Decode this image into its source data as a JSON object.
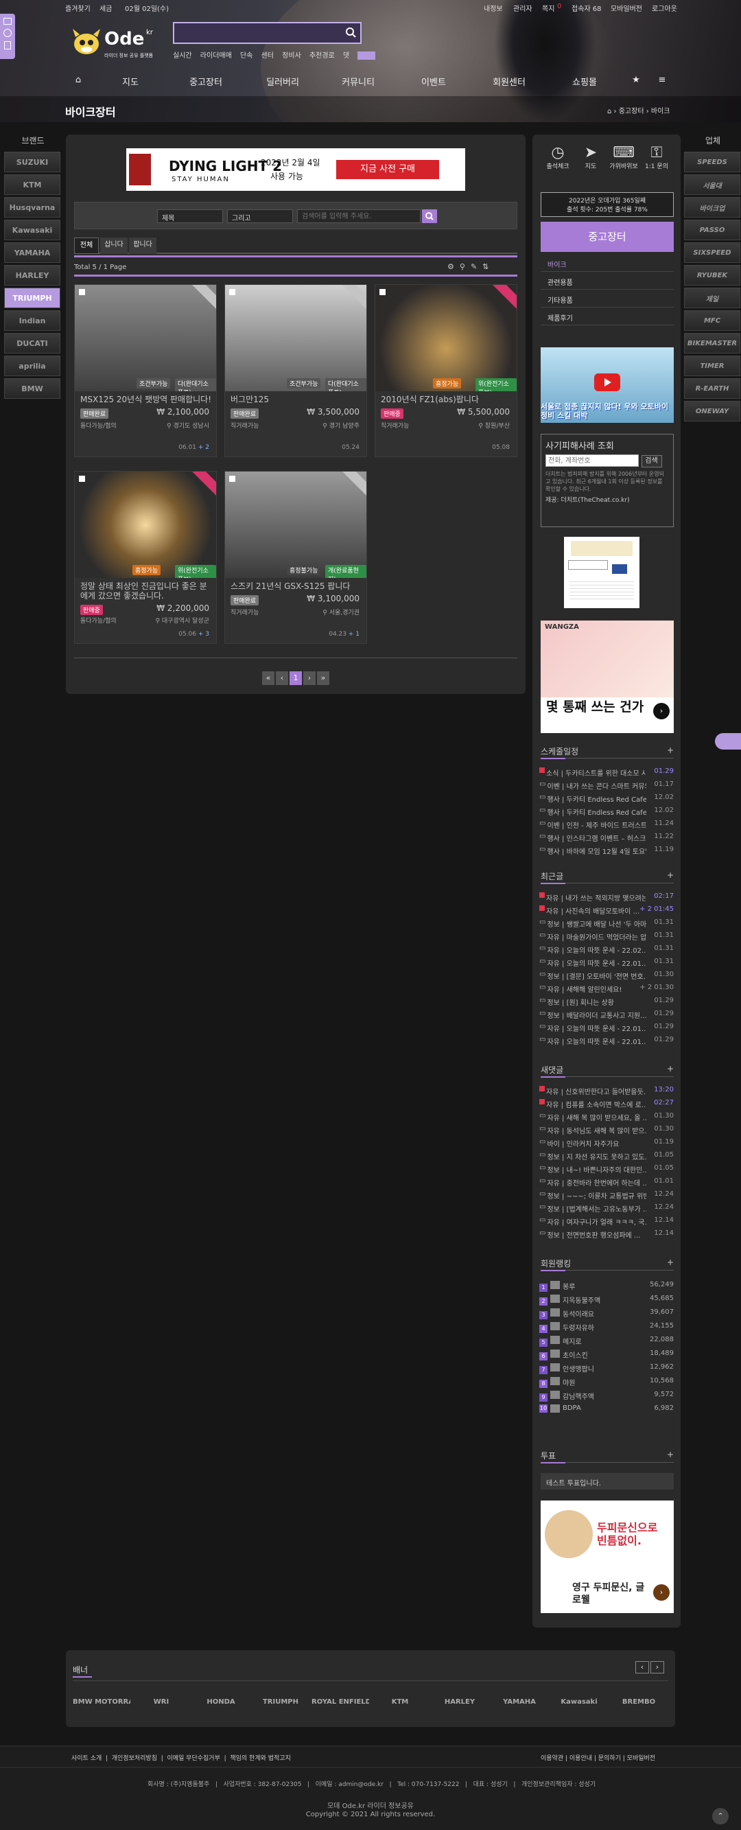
{
  "topbar": {
    "bookmark": "즐겨찾기",
    "tax": "세금",
    "date": "02월 02일(수)",
    "right": [
      "내정보",
      "관리자",
      "쪽지",
      "0",
      "접속자 68",
      "모바일버전",
      "로그아웃"
    ]
  },
  "logo": {
    "name": "Ode",
    "sub": "라이더 정보 공유 플랫폼",
    "sup": "kr"
  },
  "quick": [
    "실시간",
    "라이더매매",
    "단속",
    "센터",
    "정비사",
    "추천경로",
    "뎃"
  ],
  "nav": [
    "지도",
    "중고장터",
    "딜러버리",
    "커뮤니티",
    "이벤트",
    "회원센터",
    "쇼핑몰"
  ],
  "page": {
    "title": "바이크장터",
    "crumbs": [
      "중고장터",
      "바이크"
    ]
  },
  "left_brands_title": "브랜드",
  "left_brands": [
    "SUZUKI",
    "KTM",
    "Husqvarna",
    "Kawasaki",
    "YAMAHA",
    "HARLEY",
    "TRIUMPH",
    "Indian",
    "DUCATI",
    "aprilia",
    "BMW"
  ],
  "right_title": "업체",
  "right_brands": [
    "SPEEDS",
    "서울대",
    "바이크업",
    "PASSO",
    "SIXSPEED",
    "RYUBEK",
    "제일",
    "MFC",
    "BIKEMASTER",
    "TIMER",
    "R-EARTH",
    "ONEWAY"
  ],
  "ad": {
    "title": "DYING LIGHT 2",
    "sub": "STAY HUMAN",
    "date": "2022년 2월 4일",
    "avail": "사용 가능",
    "cta": "지금 사전 구매"
  },
  "filter": {
    "sel1": "제목",
    "sel2": "그리고",
    "ph": "검색어를 입력해 주세요."
  },
  "tabs": [
    "전체",
    "삽니다",
    "팝니다"
  ],
  "total": "Total 5 / 1 Page",
  "cards": [
    {
      "title": "MSX125 20년식 팻방역 판매합니다!",
      "badge": "판매완료",
      "price": "₩ 2,100,000",
      "loc1": "돌다가능/협의",
      "loc2": "경기도 성남시",
      "date": "06.01",
      "cmt": "+ 2",
      "tag1": "조건부가능",
      "tag2": "다(완대기소품포)"
    },
    {
      "title": "버그만125",
      "badge": "판매완료",
      "price": "₩ 3,500,000",
      "loc1": "직거래가능",
      "loc2": "경기 남양주",
      "date": "05.24",
      "cmt": "",
      "tag1": "조건부가능",
      "tag2": "다(완대기소품포)"
    },
    {
      "title": "2010년식 FZ1(abs)팝니다",
      "badge": "판매중",
      "price": "₩ 5,500,000",
      "loc1": "직거래가능",
      "loc2": "창원/부산",
      "date": "05.08",
      "cmt": "",
      "tag1": "흥정가능",
      "tag2": "위(완전기소품보)"
    },
    {
      "title": "정말 상태 최상인 진금입니다 좋은 분에게 갔으면 좋겠습니다.",
      "badge": "판매중",
      "price": "₩ 2,200,000",
      "loc1": "돌다가능/협의",
      "loc2": "대구광역시 달성군",
      "date": "05.06",
      "cmt": "+ 3",
      "tag1": "흥정가능",
      "tag2": "위(완전기소품보)"
    },
    {
      "title": "스즈키 21년식 GSX-S125 팝니다",
      "badge": "판매완료",
      "price": "₩ 3,100,000",
      "loc1": "직거래가능",
      "loc2": "서울,경기권",
      "date": "04.23",
      "cmt": "+ 1",
      "tag1": "흥정불가능",
      "tag2": "개(완료품현지)"
    }
  ],
  "pager": [
    "«",
    "‹",
    "1",
    "›",
    "»"
  ],
  "right": {
    "icons": [
      "출석체크",
      "지도",
      "가위바위보",
      "1:1 문의"
    ],
    "notice": [
      "2022년은 오데가입 365일째",
      "출석 횟수: 205번 출석률 78%"
    ],
    "menu_title": "중고장터",
    "menu": [
      "바이크",
      "관련용품",
      "기타용품",
      "제품후기"
    ],
    "yt_text": "서울로 접종 끊지지 않다! 우와 오토바이 정비 스킬 대박",
    "sagi_title": "사기피해사례 조회",
    "sagi_ph": "전화, 계좌번호",
    "sagi_btn": "검색",
    "sagi_desc": "더치트는 범죄피해 방지를 위해 2006년부터 운영되고 있습니다. 최근 6개월내 1회 이상 등록된 정보를 확인할 수 있습니다.",
    "sagi_src": "제공: 더치트(TheCheat.co.kr)",
    "ad2": "몇 통째 쓰는 건가",
    "ad2_brand": "WANGZA",
    "ad3a": "두피문신으로 빈틈없이.",
    "ad3b": "영구 두피문신, 글로웰"
  },
  "sched": {
    "title": "스케줄일정",
    "items": [
      [
        "소식 | 두카티스트를 위한 대소모 사...",
        "01.29"
      ],
      [
        "이벤 | 내가 쓰는 콘다 스마트 커뮤의 ...",
        "01.17"
      ],
      [
        "행사 | 두카티 Endless Red Cafe Day",
        "12.02"
      ],
      [
        "행사 | 두카티 Endless Red Cafe Day",
        "12.02"
      ],
      [
        "이벤 | 인천 - 제주 바이드 트러스트모",
        "11.24"
      ],
      [
        "행사 | 인스타그램 이벤트 – 허스크바나",
        "11.22"
      ],
      [
        "행사 | 바하에 모임 12월 4일 토요일 ...",
        "11.19"
      ]
    ]
  },
  "recent": {
    "title": "최근글",
    "items": [
      [
        "자유 | 내가 쓰는 적외지방 맺으려는...",
        "02:17"
      ],
      [
        "자유 | 사진속의 배달모토바이 ...",
        "+ 2 01:45"
      ],
      [
        "정보 | 쌩쌀고에 배달 나선 '두 아마...",
        "01.31"
      ],
      [
        "자유 | 마술원가이드 먹었더라는 압...",
        "01.31"
      ],
      [
        "자유 | 오늘의 따뜻 운세 - 22.02...",
        "01.31"
      ],
      [
        "자유 | 오늘의 따뜻 운세 - 22.01...",
        "01.31"
      ],
      [
        "정보 | [결문] 오토바이 '전면 번호...",
        "01.30"
      ],
      [
        "자유 | 새해해 알린인세요!",
        "+ 2 01.30"
      ],
      [
        "정보 | [원] 회니는 상황",
        "01.29"
      ],
      [
        "정보 | 배달라이더 교통사고 지원...",
        "01.29"
      ],
      [
        "자유 | 오늘의 따뜻 운세 - 22.01...",
        "01.29"
      ],
      [
        "자유 | 오늘의 따뜻 운세 - 22.01...",
        "01.29"
      ]
    ]
  },
  "comments": {
    "title": "새댓글",
    "items": [
      [
        "자유 | 신호위반한다고 들어받을듯...",
        "13:20"
      ],
      [
        "자유 | 컴퓨를 소속이면 박스에 로...",
        "02:27"
      ],
      [
        "자유 | 새해 복 많이 받으세요, 올 ...",
        "01.30"
      ],
      [
        "자유 | 동석님도 새해 복 많이 받으...",
        "01.30"
      ],
      [
        "바이 | 인라커치 자주가요",
        "01.19"
      ],
      [
        "정보 | 지 차선 유지도 못하고 있도...",
        "01.05"
      ],
      [
        "정보 | 내~! 바쁜니자주의 대한민...",
        "01.05"
      ],
      [
        "자유 | 중전바라 한번에어 하는데 ...",
        "01.01"
      ],
      [
        "정보 | ~~~; 이륜차 교통법규 위반...",
        "12.24"
      ],
      [
        "정보 | [법계해서는 고유노동부가 ...",
        "12.24"
      ],
      [
        "자유 | 여자구니가 얼래 ㅋㅋㅋ, 국...",
        "12.14"
      ],
      [
        "정보 | 전면번호판 행오섬파에 ...",
        "12.14"
      ]
    ]
  },
  "ranking": {
    "title": "회원랭킹",
    "items": [
      [
        "1",
        "봉루",
        "56,249"
      ],
      [
        "2",
        "지옥동불주액",
        "45,685"
      ],
      [
        "3",
        "동석이래요",
        "39,607"
      ],
      [
        "4",
        "두렁자유하",
        "24,155"
      ],
      [
        "5",
        "메지로",
        "22,088"
      ],
      [
        "6",
        "초이스킨",
        "18,489"
      ],
      [
        "7",
        "안생맹팝니",
        "12,962"
      ],
      [
        "8",
        "먀원",
        "10,568"
      ],
      [
        "9",
        "감님핵주액",
        "9,572"
      ],
      [
        "10",
        "BDPA",
        "6,982"
      ]
    ]
  },
  "vote": {
    "title": "투표",
    "text": "테스트 투표입니다."
  },
  "banner": {
    "title": "배너",
    "logos": [
      "BMW MOTORRAD",
      "WRI",
      "HONDA",
      "TRIUMPH",
      "ROYAL ENFIELD",
      "KTM",
      "HARLEY",
      "YAMAHA",
      "Kawasaki",
      "BREMBO"
    ]
  },
  "footer": {
    "left": [
      "사이트 소개",
      "개인정보처리방침",
      "이메일 무단수집거부",
      "책임의 한계와 법적고지"
    ],
    "right": [
      "이용약관",
      "이용안내",
      "문의하기",
      "모바일버전"
    ],
    "info": [
      "회사명 : (주)지엠돌불주",
      "사업자번호 : 382-87-02305",
      "이메일 : admin@ode.kr",
      "Tel : 070-7137-5222",
      "대표 : 성성기",
      "개인정보관리책임자 : 성성기"
    ],
    "name": "모데 Ode.kr 라이더 정보공유",
    "copy": "Copyright © 2021 All rights reserved."
  },
  "colors": {
    "accent": "#a77cd6",
    "red": "#e0354a",
    "green": "#2f8f46",
    "blue": "#2f6fd1"
  }
}
